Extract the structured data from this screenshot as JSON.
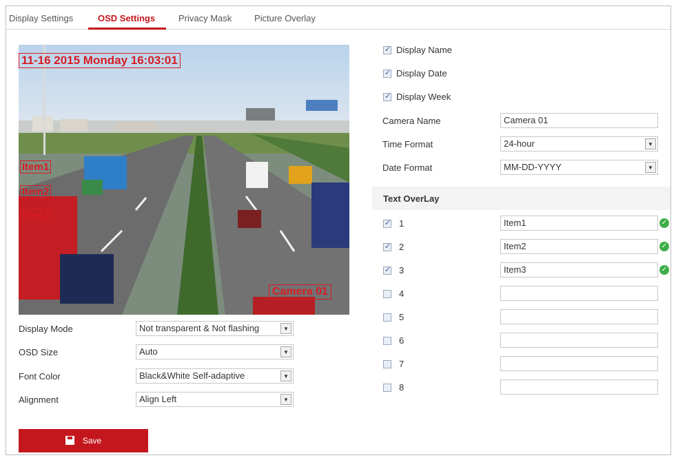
{
  "tabs": [
    {
      "label": "Display Settings"
    },
    {
      "label": "OSD Settings"
    },
    {
      "label": "Privacy Mask"
    },
    {
      "label": "Picture Overlay"
    }
  ],
  "preview": {
    "date_text": "11-16 2015 Monday 16:03:01",
    "items": [
      "Item1",
      "Item2",
      "Item3"
    ],
    "camera_text": "Camera 01"
  },
  "left_form": {
    "display_mode": {
      "label": "Display Mode",
      "value": "Not transparent & Not flashing"
    },
    "osd_size": {
      "label": "OSD Size",
      "value": "Auto"
    },
    "font_color": {
      "label": "Font Color",
      "value": "Black&White Self-adaptive"
    },
    "alignment": {
      "label": "Alignment",
      "value": "Align Left"
    }
  },
  "save_label": "Save",
  "display_options": [
    {
      "label": "Display Name",
      "checked": true
    },
    {
      "label": "Display Date",
      "checked": true
    },
    {
      "label": "Display Week",
      "checked": true
    }
  ],
  "camera_name": {
    "label": "Camera Name",
    "value": "Camera 01"
  },
  "time_format": {
    "label": "Time Format",
    "value": "24-hour"
  },
  "date_format": {
    "label": "Date Format",
    "value": "MM-DD-YYYY"
  },
  "text_overlay": {
    "title": "Text OverLay",
    "rows": [
      {
        "num": "1",
        "checked": true,
        "value": "Item1",
        "valid": true
      },
      {
        "num": "2",
        "checked": true,
        "value": "Item2",
        "valid": true
      },
      {
        "num": "3",
        "checked": true,
        "value": "Item3",
        "valid": true
      },
      {
        "num": "4",
        "checked": false,
        "value": "",
        "valid": false
      },
      {
        "num": "5",
        "checked": false,
        "value": "",
        "valid": false
      },
      {
        "num": "6",
        "checked": false,
        "value": "",
        "valid": false
      },
      {
        "num": "7",
        "checked": false,
        "value": "",
        "valid": false
      },
      {
        "num": "8",
        "checked": false,
        "value": "",
        "valid": false
      }
    ]
  },
  "colors": {
    "accent": "#c4171d",
    "osd_text": "#d81c22",
    "valid": "#3fae49"
  }
}
